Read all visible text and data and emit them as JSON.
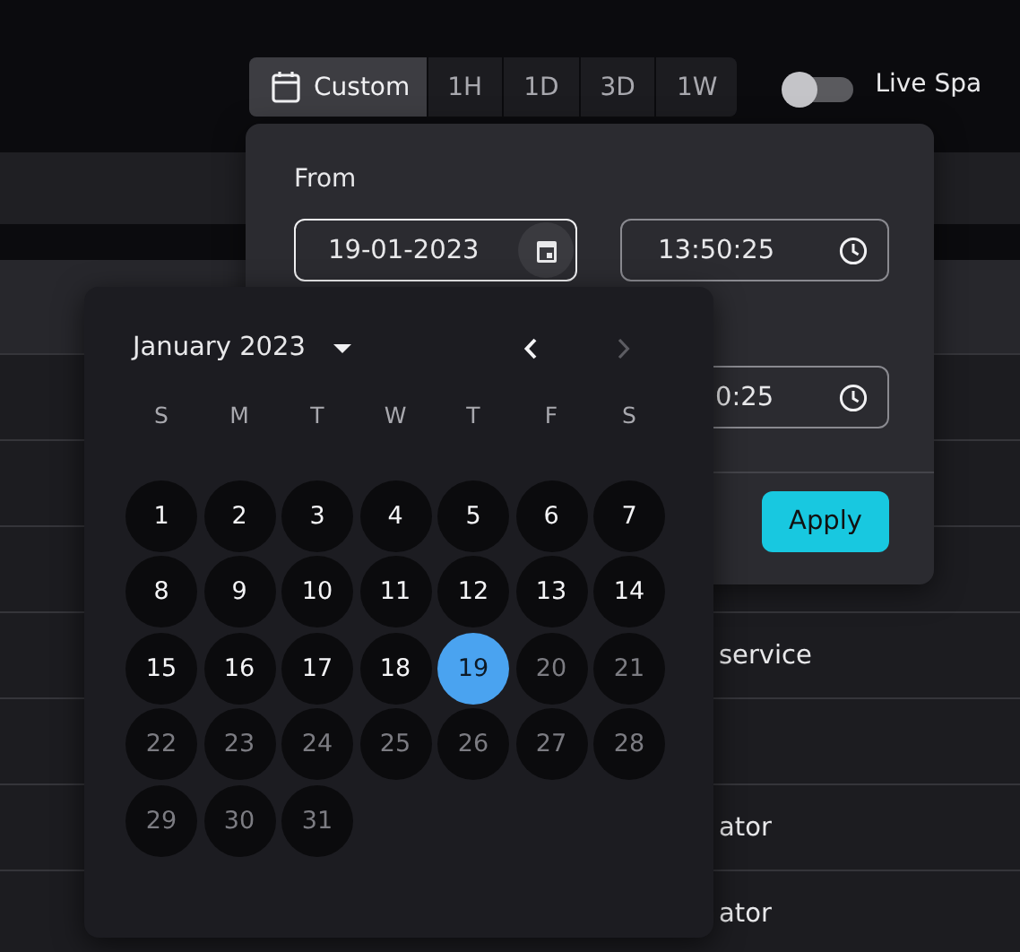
{
  "toolbar": {
    "ranges": [
      {
        "label": "Custom",
        "kind": "custom",
        "selected": true
      },
      {
        "label": "1H",
        "kind": "preset",
        "selected": false
      },
      {
        "label": "1D",
        "kind": "preset",
        "selected": false
      },
      {
        "label": "3D",
        "kind": "preset",
        "selected": false
      },
      {
        "label": "1W",
        "kind": "preset",
        "selected": false
      }
    ],
    "live_toggle": {
      "on": false,
      "label": "Live Spa"
    }
  },
  "table": {
    "rows": [
      {},
      {},
      {},
      {
        "column_3": "service"
      },
      {},
      {
        "column_3": "ator"
      },
      {
        "column_3": "ator"
      }
    ]
  },
  "range_popover": {
    "from_label": "From",
    "from_date": "19-01-2023",
    "from_time": "13:50:25",
    "to_time": "0:25",
    "apply": "Apply"
  },
  "calendar": {
    "month": "January 2023",
    "prev_disabled": false,
    "next_disabled": true,
    "weekdays": [
      "S",
      "M",
      "T",
      "W",
      "T",
      "F",
      "S"
    ],
    "days": [
      {
        "label": "1",
        "selected": false,
        "disabled": false
      },
      {
        "label": "2",
        "selected": false,
        "disabled": false
      },
      {
        "label": "3",
        "selected": false,
        "disabled": false
      },
      {
        "label": "4",
        "selected": false,
        "disabled": false
      },
      {
        "label": "5",
        "selected": false,
        "disabled": false
      },
      {
        "label": "6",
        "selected": false,
        "disabled": false
      },
      {
        "label": "7",
        "selected": false,
        "disabled": false
      },
      {
        "label": "8",
        "selected": false,
        "disabled": false
      },
      {
        "label": "9",
        "selected": false,
        "disabled": false
      },
      {
        "label": "10",
        "selected": false,
        "disabled": false
      },
      {
        "label": "11",
        "selected": false,
        "disabled": false
      },
      {
        "label": "12",
        "selected": false,
        "disabled": false
      },
      {
        "label": "13",
        "selected": false,
        "disabled": false
      },
      {
        "label": "14",
        "selected": false,
        "disabled": false
      },
      {
        "label": "15",
        "selected": false,
        "disabled": false
      },
      {
        "label": "16",
        "selected": false,
        "disabled": false
      },
      {
        "label": "17",
        "selected": false,
        "disabled": false
      },
      {
        "label": "18",
        "selected": false,
        "disabled": false
      },
      {
        "label": "19",
        "selected": true,
        "disabled": false
      },
      {
        "label": "20",
        "selected": false,
        "disabled": true
      },
      {
        "label": "21",
        "selected": false,
        "disabled": true
      },
      {
        "label": "22",
        "selected": false,
        "disabled": true
      },
      {
        "label": "23",
        "selected": false,
        "disabled": true
      },
      {
        "label": "24",
        "selected": false,
        "disabled": true
      },
      {
        "label": "25",
        "selected": false,
        "disabled": true
      },
      {
        "label": "26",
        "selected": false,
        "disabled": true
      },
      {
        "label": "27",
        "selected": false,
        "disabled": true
      },
      {
        "label": "28",
        "selected": false,
        "disabled": true
      },
      {
        "label": "29",
        "selected": false,
        "disabled": true
      },
      {
        "label": "30",
        "selected": false,
        "disabled": true
      },
      {
        "label": "31",
        "selected": false,
        "disabled": true
      }
    ]
  }
}
